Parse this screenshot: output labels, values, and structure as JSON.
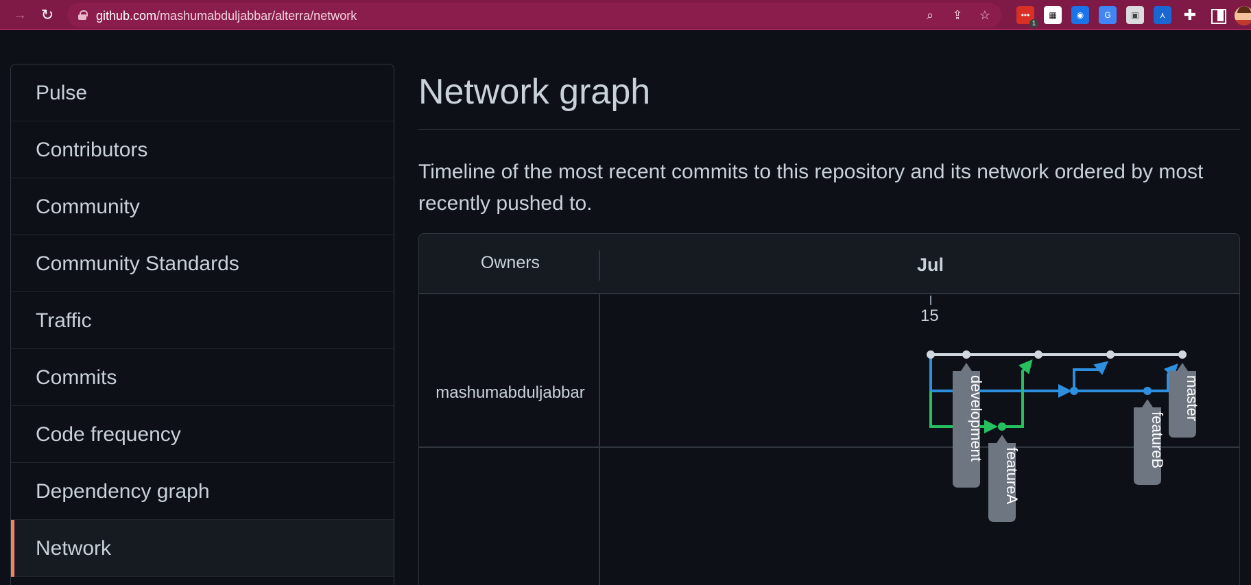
{
  "browser": {
    "url_host": "github.com",
    "url_path": "/mashumabduljabbar/alterra/network",
    "extension_badge": "1",
    "colors": {
      "toolbar": "#7e1a45"
    }
  },
  "sidebar": {
    "items": [
      {
        "label": "Pulse",
        "active": false
      },
      {
        "label": "Contributors",
        "active": false
      },
      {
        "label": "Community",
        "active": false
      },
      {
        "label": "Community Standards",
        "active": false
      },
      {
        "label": "Traffic",
        "active": false
      },
      {
        "label": "Commits",
        "active": false
      },
      {
        "label": "Code frequency",
        "active": false
      },
      {
        "label": "Dependency graph",
        "active": false
      },
      {
        "label": "Network",
        "active": true
      }
    ]
  },
  "main": {
    "title": "Network graph",
    "description": "Timeline of the most recent commits to this repository and its network ordered by most recently pushed to."
  },
  "graph": {
    "owners_header": "Owners",
    "month": "Jul",
    "day": "15",
    "owner": "mashumabduljabbar",
    "branches": [
      "development",
      "featureA",
      "featureB",
      "master"
    ],
    "colors": {
      "master": "#d0d7de",
      "development": "#2f8fdf",
      "featureA": "#26c061",
      "label_bg": "#6e7681",
      "accent": "#f78166"
    }
  }
}
